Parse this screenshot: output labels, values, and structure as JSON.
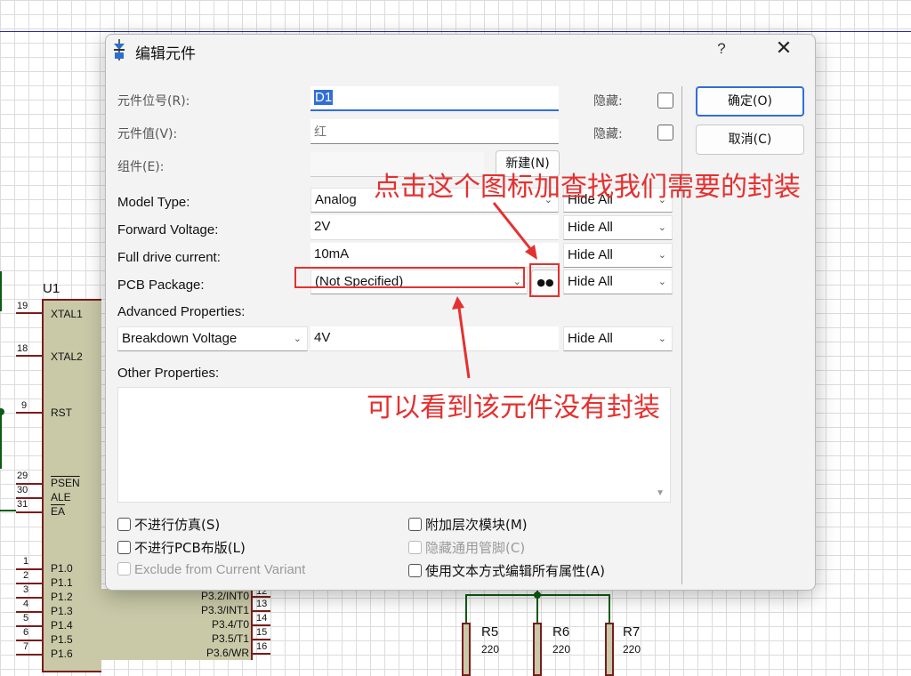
{
  "schematic": {
    "u1": {
      "ref": "U1",
      "left_pins": [
        {
          "num": "19",
          "name": "XTAL1"
        },
        {
          "num": "18",
          "name": "XTAL2"
        },
        {
          "num": "9",
          "name": "RST"
        },
        {
          "num": "29",
          "name": "PSEN"
        },
        {
          "num": "30",
          "name": "ALE"
        },
        {
          "num": "31",
          "name": "EA"
        },
        {
          "num": "1",
          "name": "P1.0"
        },
        {
          "num": "2",
          "name": "P1.1"
        },
        {
          "num": "3",
          "name": "P1.2"
        },
        {
          "num": "4",
          "name": "P1.3"
        },
        {
          "num": "5",
          "name": "P1.4"
        },
        {
          "num": "6",
          "name": "P1.5"
        },
        {
          "num": "7",
          "name": "P1.6"
        }
      ],
      "right_pins": [
        {
          "num": "12",
          "name": "P3.2/INT0"
        },
        {
          "num": "13",
          "name": "P3.3/INT1"
        },
        {
          "num": "14",
          "name": "P3.4/T0"
        },
        {
          "num": "15",
          "name": "P3.5/T1"
        },
        {
          "num": "16",
          "name": "P3.6/WR"
        }
      ]
    },
    "resistors": [
      {
        "ref": "R5",
        "value": "220"
      },
      {
        "ref": "R6",
        "value": "220"
      },
      {
        "ref": "R7",
        "value": "220"
      }
    ]
  },
  "dialog": {
    "title": "编辑元件",
    "help": "?",
    "close": "✕",
    "part_ref": {
      "label": "元件位号(R):",
      "value": "D1",
      "hidden_label": "隐藏:"
    },
    "part_value": {
      "label": "元件值(V):",
      "value": "红",
      "hidden_label": "隐藏:"
    },
    "component": {
      "label": "组件(E):",
      "value": "",
      "new_button": "新建(N)"
    },
    "ok_button": "确定(O)",
    "cancel_button": "取消(C)",
    "properties": [
      {
        "label": "Model Type:",
        "value": "Analog",
        "visibility": "Hide All"
      },
      {
        "label": "Forward Voltage:",
        "value": "2V",
        "visibility": "Hide All"
      },
      {
        "label": "Full drive current:",
        "value": "10mA",
        "visibility": "Hide All"
      },
      {
        "label": "PCB Package:",
        "value": "(Not Specified)",
        "visibility": "Hide All"
      }
    ],
    "advanced": {
      "label": "Advanced Properties:",
      "property": "Breakdown Voltage",
      "value": "4V",
      "visibility": "Hide All"
    },
    "other_label": "Other Properties:",
    "checkboxes_left": [
      {
        "label": "不进行仿真(S)",
        "checked": false,
        "enabled": true
      },
      {
        "label": "不进行PCB布版(L)",
        "checked": false,
        "enabled": true
      },
      {
        "label": "Exclude from Current Variant",
        "checked": false,
        "enabled": false
      }
    ],
    "checkboxes_right": [
      {
        "label": "附加层次模块(M)",
        "checked": false,
        "enabled": true
      },
      {
        "label": "隐藏通用管脚(C)",
        "checked": false,
        "enabled": false
      },
      {
        "label": "使用文本方式编辑所有属性(A)",
        "checked": false,
        "enabled": true
      }
    ]
  },
  "annotations": {
    "browse_hint": "点击这个图标加查找我们需要的封装",
    "no_package_hint": "可以看到该元件没有封装",
    "color": "#e53030"
  }
}
